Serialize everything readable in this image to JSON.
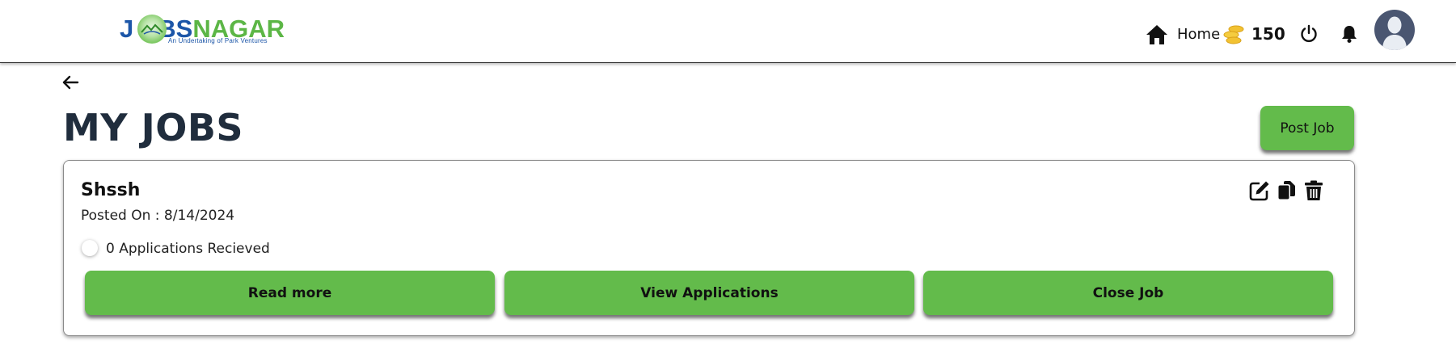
{
  "header": {
    "logo": {
      "letters_left": "J",
      "letters_mid": "BS",
      "letters_right": "NAGAR",
      "tagline": "An Undertaking of Park Ventures",
      "colors": {
        "blue": "#1c56a8",
        "green": "#5cb646"
      }
    },
    "nav": {
      "home_label": "Home",
      "home_icon": "home-icon",
      "coins_icon": "coins-icon",
      "coins_value": "150",
      "power_icon": "power-icon",
      "bell_icon": "bell-icon",
      "avatar_icon": "user-avatar"
    }
  },
  "page": {
    "back_icon": "arrow-left-icon",
    "title": "MY JOBS",
    "post_job_label": "Post Job"
  },
  "jobs": [
    {
      "title": "Shssh",
      "posted_label": "Posted On : ",
      "posted_date": "8/14/2024",
      "applications_text": "0 Applications Recieved",
      "actions": [
        "edit-icon",
        "copy-icon",
        "trash-icon"
      ],
      "buttons": {
        "read_more": "Read more",
        "view_applications": "View Applications",
        "close_job": "Close Job"
      }
    }
  ],
  "colors": {
    "accent_green": "#63bb4b",
    "title_navy": "#202d3d",
    "avatar_bg": "#4a5671"
  }
}
